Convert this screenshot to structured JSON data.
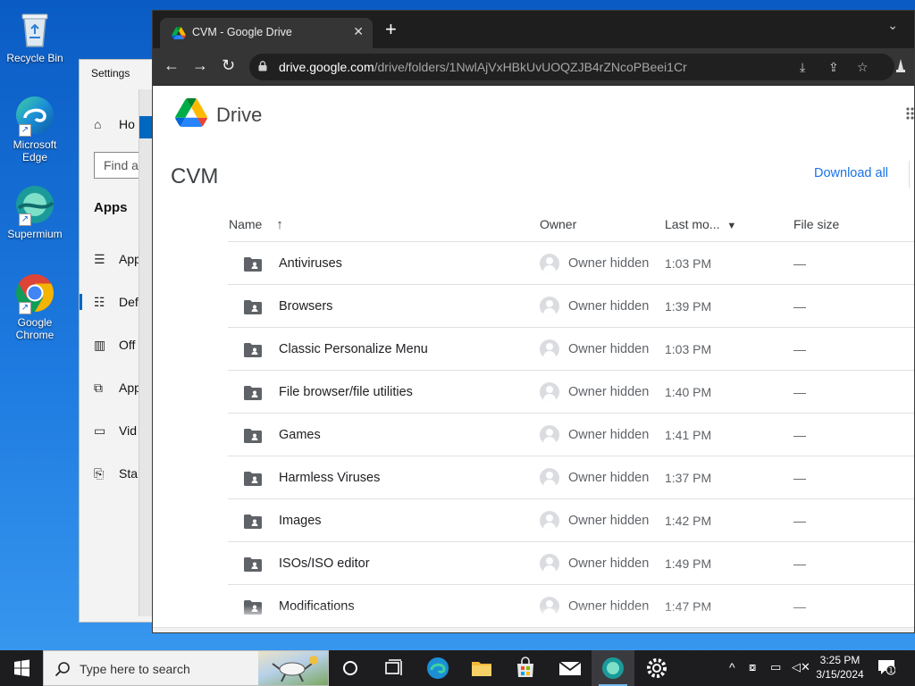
{
  "desktop": {
    "icons": [
      {
        "label": "Recycle Bin"
      },
      {
        "label": "Microsoft Edge"
      },
      {
        "label": "Supermium"
      },
      {
        "label": "Google Chrome"
      }
    ]
  },
  "settings": {
    "title": "Settings",
    "home_label": "Ho",
    "find_placeholder": "Find a",
    "section": "Apps",
    "items": [
      {
        "label": "App",
        "icon": "apps-features-icon"
      },
      {
        "label": "Def",
        "icon": "default-apps-icon"
      },
      {
        "label": "Off",
        "icon": "offline-maps-icon"
      },
      {
        "label": "App",
        "icon": "apps-websites-icon"
      },
      {
        "label": "Vid",
        "icon": "video-playback-icon"
      },
      {
        "label": "Sta",
        "icon": "startup-icon"
      }
    ]
  },
  "browser": {
    "tab_title": "CVM - Google Drive",
    "url_host": "drive.google.com",
    "url_path": "/drive/folders/1NwlAjVxHBkUvUOQZJB4rZNcoPBeei1Cr"
  },
  "drive": {
    "brand": "Drive",
    "folder_title": "CVM",
    "download_all": "Download all",
    "columns": {
      "name": "Name",
      "owner": "Owner",
      "modified": "Last mo...",
      "size": "File size"
    },
    "rows": [
      {
        "name": "Antiviruses",
        "owner": "Owner hidden",
        "modified": "1:03 PM",
        "size": "—"
      },
      {
        "name": "Browsers",
        "owner": "Owner hidden",
        "modified": "1:39 PM",
        "size": "—"
      },
      {
        "name": "Classic Personalize Menu",
        "owner": "Owner hidden",
        "modified": "1:03 PM",
        "size": "—"
      },
      {
        "name": "File browser/file utilities",
        "owner": "Owner hidden",
        "modified": "1:40 PM",
        "size": "—"
      },
      {
        "name": "Games",
        "owner": "Owner hidden",
        "modified": "1:41 PM",
        "size": "—"
      },
      {
        "name": "Harmless Viruses",
        "owner": "Owner hidden",
        "modified": "1:37 PM",
        "size": "—"
      },
      {
        "name": "Images",
        "owner": "Owner hidden",
        "modified": "1:42 PM",
        "size": "—"
      },
      {
        "name": "ISOs/ISO editor",
        "owner": "Owner hidden",
        "modified": "1:49 PM",
        "size": "—"
      },
      {
        "name": "Modifications",
        "owner": "Owner hidden",
        "modified": "1:47 PM",
        "size": "—"
      }
    ]
  },
  "taskbar": {
    "search_placeholder": "Type here to search",
    "time": "3:25 PM",
    "date": "3/15/2024",
    "notification_count": "1"
  },
  "colors": {
    "accent": "#1a73e8",
    "desktop": "#1e7be0",
    "taskbar": "#1d1d1f"
  }
}
